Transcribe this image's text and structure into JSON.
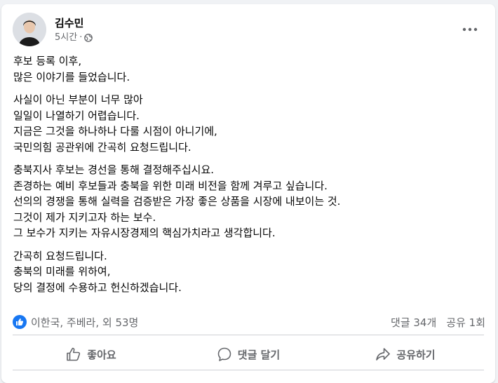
{
  "post": {
    "author": "김수민",
    "time": "5시간",
    "dot": "·",
    "audience_icon": "globe-icon",
    "more_icon": "more-icon",
    "paragraphs": [
      [
        "후보 등록 이후,",
        "많은 이야기를 들었습니다."
      ],
      [
        "사실이 아닌 부분이 너무 많아",
        "일일이 나열하기 어렵습니다.",
        "지금은 그것을 하나하나 다룰 시점이 아니기에,",
        "국민의힘 공관위에 간곡히 요청드립니다."
      ],
      [
        "충북지사 후보는 경선을 통해 결정해주십시요.",
        "존경하는 예비 후보들과 충북을 위한 미래 비전을 함께 겨루고 싶습니다.",
        "선의의 경쟁을 통해 실력을 검증받은 가장 좋은 상품을 시장에 내보이는 것.",
        "그것이 제가 지키고자 하는 보수.",
        "그 보수가 지키는 자유시장경제의 핵심가치라고 생각합니다."
      ],
      [
        "간곡히 요청드립니다.",
        "충북의 미래를 위하여,",
        "당의 결정에 수용하고 헌신하겠습니다."
      ]
    ]
  },
  "reactions": {
    "summary": "이한국, 주베라, 외 53명",
    "comments": "댓글 34개",
    "shares": "공유 1회",
    "like_color": "#1877f2"
  },
  "actions": {
    "like": "좋아요",
    "comment": "댓글 달기",
    "share": "공유하기"
  }
}
